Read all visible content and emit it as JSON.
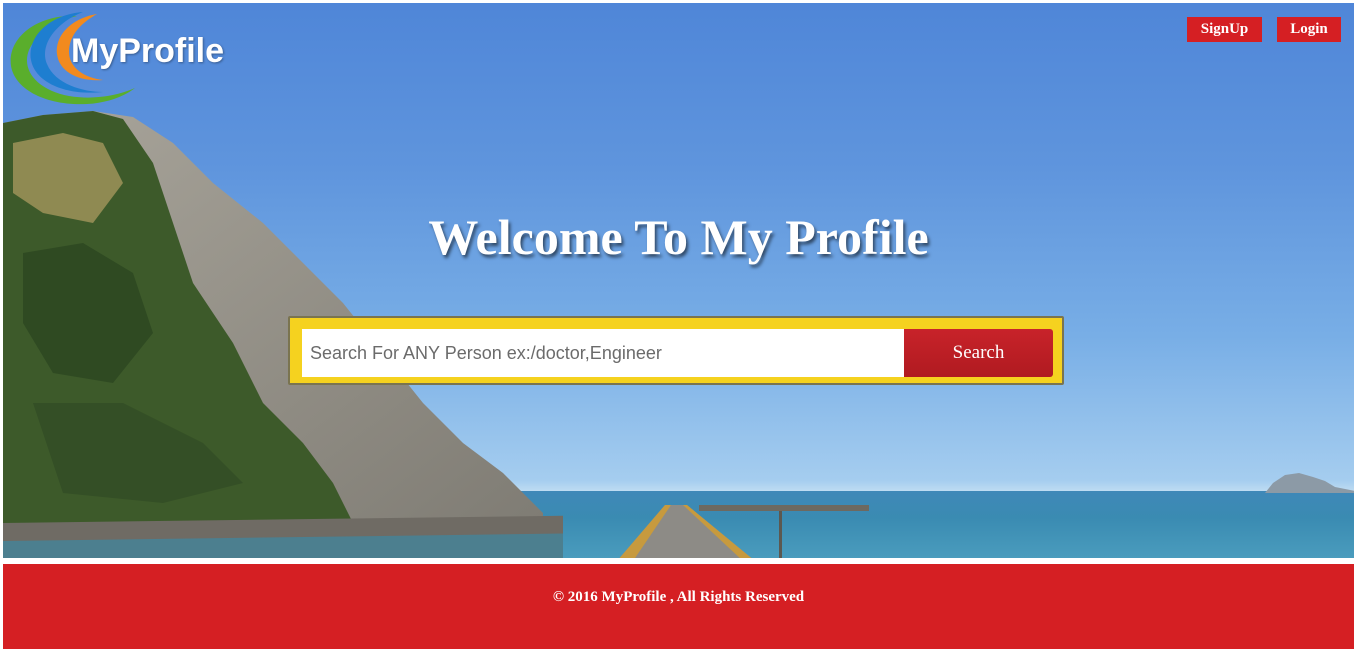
{
  "header": {
    "logo_text": "MyProfile",
    "signup_label": "SignUp",
    "login_label": "Login"
  },
  "hero": {
    "headline": "Welcome To My Profile"
  },
  "search": {
    "placeholder": "Search For ANY Person ex:/doctor,Engineer",
    "button_label": "Search"
  },
  "footer": {
    "copyright": "© 2016 MyProfile , All Rights Reserved"
  },
  "colors": {
    "accent_red": "#d51f23",
    "search_frame": "#f5d21f",
    "search_button": "#b01a20"
  }
}
